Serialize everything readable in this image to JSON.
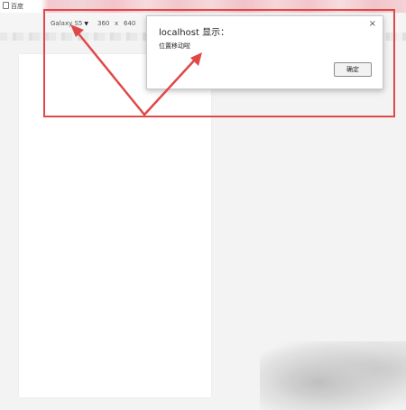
{
  "browser": {
    "bookmark_label": "百度",
    "bookmark_icon": "bookmark-icon"
  },
  "device_toolbar": {
    "device_name": "Galaxy S5",
    "caret": "▼",
    "width": "360",
    "separator": "x",
    "height": "640"
  },
  "alert": {
    "title": "localhost 显示：",
    "message": "位置移动啦",
    "ok_label": "确定",
    "close_glyph": "×"
  },
  "annotation": {
    "highlight_color": "#e04848",
    "arrow_color": "#e04848"
  }
}
